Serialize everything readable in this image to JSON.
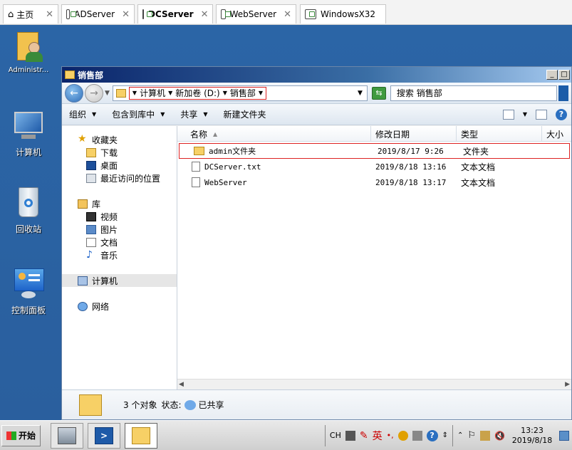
{
  "host_tabs": [
    {
      "label": "主页",
      "icon": "home-icon",
      "active": false
    },
    {
      "label": "ADServer",
      "icon": "vm-icon",
      "active": false
    },
    {
      "label": "DCServer",
      "icon": "vm-icon",
      "active": true
    },
    {
      "label": "WebServer",
      "icon": "vm-icon",
      "active": false
    },
    {
      "label": "WindowsX32",
      "icon": "vm-icon",
      "active": false
    }
  ],
  "desktop_icons": [
    {
      "label": "Administr...",
      "icon": "user-folder-icon"
    },
    {
      "label": "计算机",
      "icon": "computer-icon"
    },
    {
      "label": "回收站",
      "icon": "recycle-bin-icon"
    },
    {
      "label": "控制面板",
      "icon": "control-panel-icon"
    }
  ],
  "window": {
    "title": "销售部",
    "breadcrumbs": [
      "计算机",
      "新加卷 (D:)",
      "销售部"
    ],
    "search_placeholder": "搜索 销售部",
    "commands": [
      "组织",
      "包含到库中",
      "共享",
      "新建文件夹"
    ]
  },
  "nav_pane": {
    "favorites_label": "收藏夹",
    "favorites": [
      "下载",
      "桌面",
      "最近访问的位置"
    ],
    "libraries_label": "库",
    "libraries": [
      "视频",
      "图片",
      "文档",
      "音乐"
    ],
    "computer_label": "计算机",
    "network_label": "网络"
  },
  "columns": {
    "name": "名称",
    "date": "修改日期",
    "type": "类型",
    "size": "大小"
  },
  "files": [
    {
      "name": "admin文件夹",
      "date": "2019/8/17 9:26",
      "type": "文件夹",
      "icon": "folder-icon"
    },
    {
      "name": "DCServer.txt",
      "date": "2019/8/18 13:16",
      "type": "文本文档",
      "icon": "text-file-icon"
    },
    {
      "name": "WebServer",
      "date": "2019/8/18 13:17",
      "type": "文本文档",
      "icon": "text-file-icon"
    }
  ],
  "details": {
    "count": "3 个对象",
    "status_label": "状态:",
    "status_value": "已共享"
  },
  "taskbar": {
    "start_label": "开始",
    "tray": {
      "lang": "CH",
      "ime_text": "英",
      "time": "13:23",
      "date": "2019/8/18"
    }
  }
}
